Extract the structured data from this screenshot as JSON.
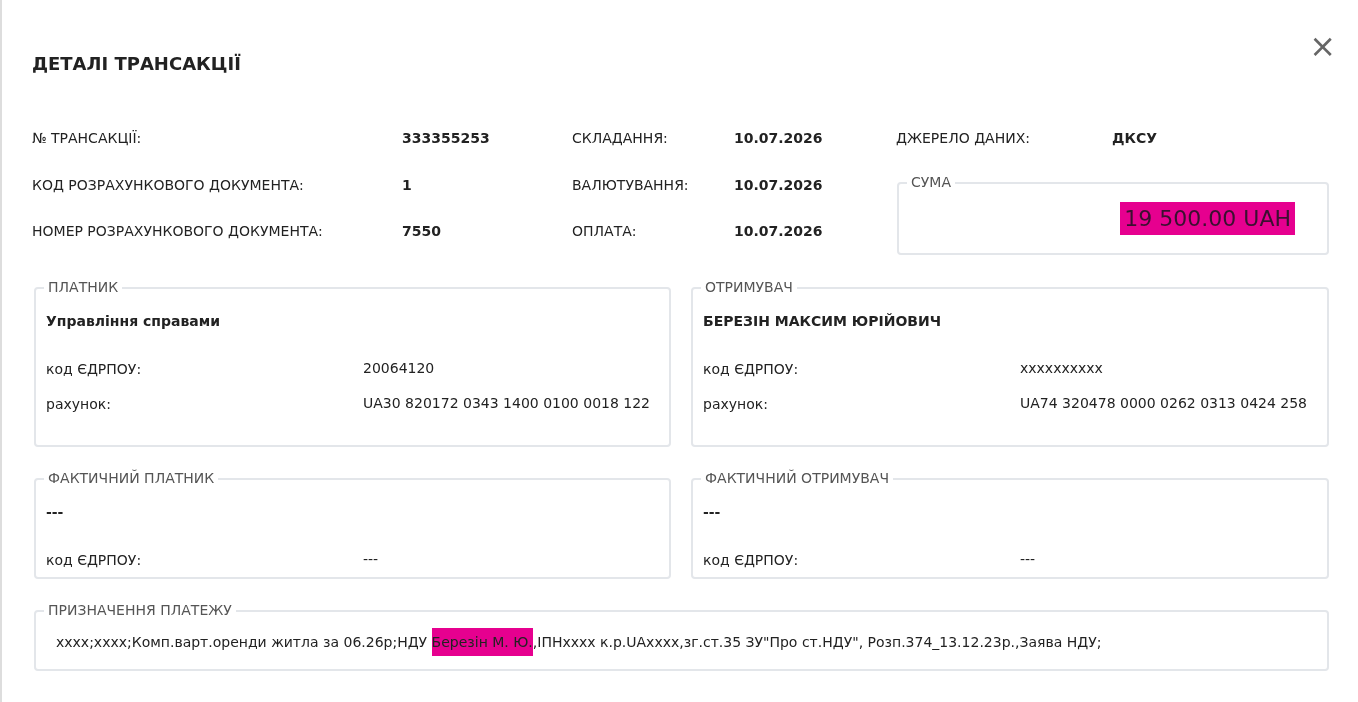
{
  "dialog": {
    "title": "ДЕТАЛІ ТРАНСАКЦІЇ",
    "close": "×"
  },
  "details": [
    {
      "label": "№ ТРАНСАКЦІЇ:",
      "value": "333355253"
    },
    {
      "label": "СКЛАДАННЯ:",
      "value": "10.07.2026"
    },
    {
      "label": "ДЖЕРЕЛО ДАНИХ:",
      "value": "ДКСУ"
    },
    {
      "label": "КОД РОЗРАХУНКОВОГО ДОКУМЕНТА:",
      "value": "1"
    },
    {
      "label": "ВАЛЮТУВАННЯ:",
      "value": "10.07.2026"
    },
    {
      "label": "НОМЕР РОЗРАХУНКОВОГО ДОКУМЕНТА:",
      "value": "7550"
    },
    {
      "label": "ОПЛАТА:",
      "value": "10.07.2026"
    }
  ],
  "amount": {
    "legend": "СУМА",
    "value": "19 500.00 UAH",
    "highlighted": true
  },
  "parties": [
    {
      "legend": "ПЛАТНИК",
      "name": "Управління справами",
      "rows": [
        {
          "label": "код ЄДРПОУ:",
          "value": "20064120"
        },
        {
          "label": "рахунок:",
          "value": "UA30 820172 0343 1400 0100 0018 122"
        }
      ]
    },
    {
      "legend": "ОТРИМУВАЧ",
      "name": "БЕРЕЗІН МАКСИМ ЮРІЙОВИЧ",
      "rows": [
        {
          "label": "код ЄДРПОУ:",
          "value": "xxxxxxxxxx"
        },
        {
          "label": "рахунок:",
          "value": "UA74 320478 0000 0262 0313 0424 258"
        }
      ]
    },
    {
      "legend": "ФАКТИЧНИЙ ПЛАТНИК",
      "name": "---",
      "rows": [
        {
          "label": "код ЄДРПОУ:",
          "value": "---"
        }
      ]
    },
    {
      "legend": "ФАКТИЧНИЙ ОТРИМУВАЧ",
      "name": "---",
      "rows": [
        {
          "label": "код ЄДРПОУ:",
          "value": "---"
        }
      ]
    }
  ],
  "purpose": {
    "legend": "ПРИЗНАЧЕННЯ ПЛАТЕЖУ",
    "segments": [
      {
        "text": "xxxx;xxxx;Комп.варт.оренди житла за 06.26р;НДУ ",
        "highlighted": false
      },
      {
        "text": "Березін М. Ю.",
        "highlighted": true
      },
      {
        "text": ",ІПНxxxx к.р.UAxxxx,зг.ст.35 ЗУ\"Про ст.НДУ\", Розп.374_13.12.23р.,Заява НДУ;",
        "highlighted": false
      }
    ]
  }
}
